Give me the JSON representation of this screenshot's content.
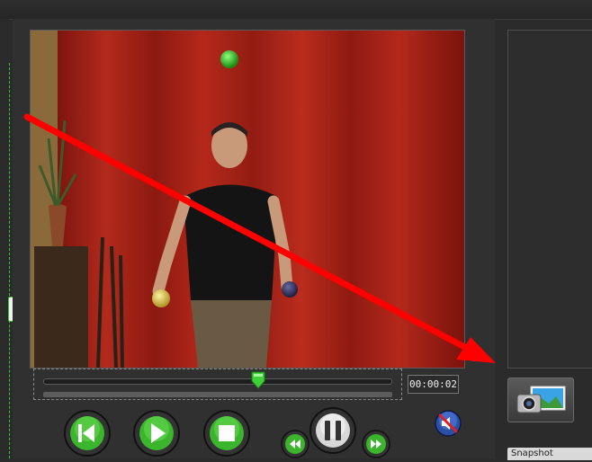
{
  "player": {
    "time_display": "00:00:02",
    "seek_progress": 0.62
  },
  "controls": {
    "buttons": [
      {
        "name": "previous-button",
        "icon": "skip-previous-icon"
      },
      {
        "name": "play-button",
        "icon": "play-icon"
      },
      {
        "name": "stop-button",
        "icon": "stop-icon"
      },
      {
        "name": "rewind-button",
        "icon": "rewind-icon"
      },
      {
        "name": "pause-button",
        "icon": "pause-icon"
      },
      {
        "name": "fast-forward-button",
        "icon": "fast-forward-icon"
      },
      {
        "name": "mute-button",
        "icon": "speaker-mute-icon"
      },
      {
        "name": "snapshot-button",
        "icon": "camera-picture-icon"
      }
    ]
  },
  "status_label": "Snapshot",
  "colors": {
    "accent_green": "#3bbf2c",
    "annotation_arrow": "#ff0000",
    "curtain": "#a51f16"
  }
}
